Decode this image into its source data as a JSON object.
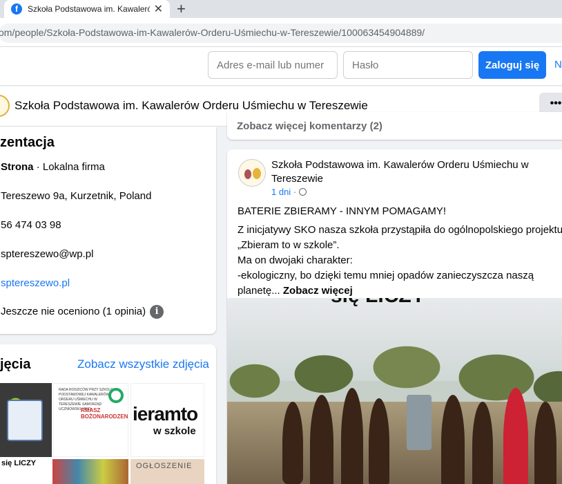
{
  "browser": {
    "tab_title": "Szkoła Podstawowa im. Kawalerów Orderu Uśmiechu w Tereszewie",
    "tab_favicon": "f",
    "url": "om/people/Szkoła-Podstawowa-im-Kawalerów-Orderu-Uśmiechu-w-Tereszewie/100063454904889/",
    "new_tab": "+"
  },
  "login": {
    "email_placeholder": "Adres e-mail lub numer",
    "password_placeholder": "Hasło",
    "login_label": "Zaloguj się",
    "new_link": "N"
  },
  "page": {
    "name": "Szkoła Podstawowa im. Kawalerów Orderu Uśmiechu w Tereszewie",
    "more_label": "•••"
  },
  "intro": {
    "heading": "zentacja",
    "category_bold": "Strona",
    "category_rest": " · Lokalna firma",
    "address": "Tereszewo 9a, Kurzetnik, Poland",
    "phone": "56 474 03 98",
    "email": "sptereszewo@wp.pl",
    "website": "sptereszewo.pl",
    "rating": "Jeszcze nie oceniono (1 opinia)",
    "info_icon": "i"
  },
  "photos": {
    "heading": "jęcia",
    "see_all": "Zobacz wszystkie zdjęcia",
    "thumb2_text": "RADA RODZICÓW PRZY SZKOLE PODSTAWOWEJ KAWALERÓW ORDERU UŚMIECHU W TERESZEWIE SAMORZĄD UCZNIOWSKI I SKO",
    "thumb2_red": "RMASZ BOŻONARODZENIOW",
    "thumb3_big": "ieramto",
    "thumb3_small": "w szkole",
    "thumb4_text": "się LICZY",
    "thumb6_text": "OGŁOSZENIE"
  },
  "feed": {
    "prev_more_comments": "Zobacz więcej komentarzy (2)",
    "post": {
      "author": "Szkoła Podstawowa im. Kawalerów Orderu Uśmiechu w Tereszewie",
      "time": "1 dni",
      "separator": " · ",
      "headline": "BATERIE ZBIERAMY - INNYM POMAGAMY!",
      "line1": "Z inicjatywy SKO nasza szkoła przystąpiła do ogólnopolskiego projektu",
      "line2": "„Zbieram to w szkole”.",
      "line3": "Ma on dwojaki charakter:",
      "line4": "-ekologiczny, bo dzięki temu mniej opadów zanieczyszcza naszą",
      "line5": "planetę...",
      "see_more": "Zobacz więcej",
      "image_caption": "się LICZY"
    }
  }
}
